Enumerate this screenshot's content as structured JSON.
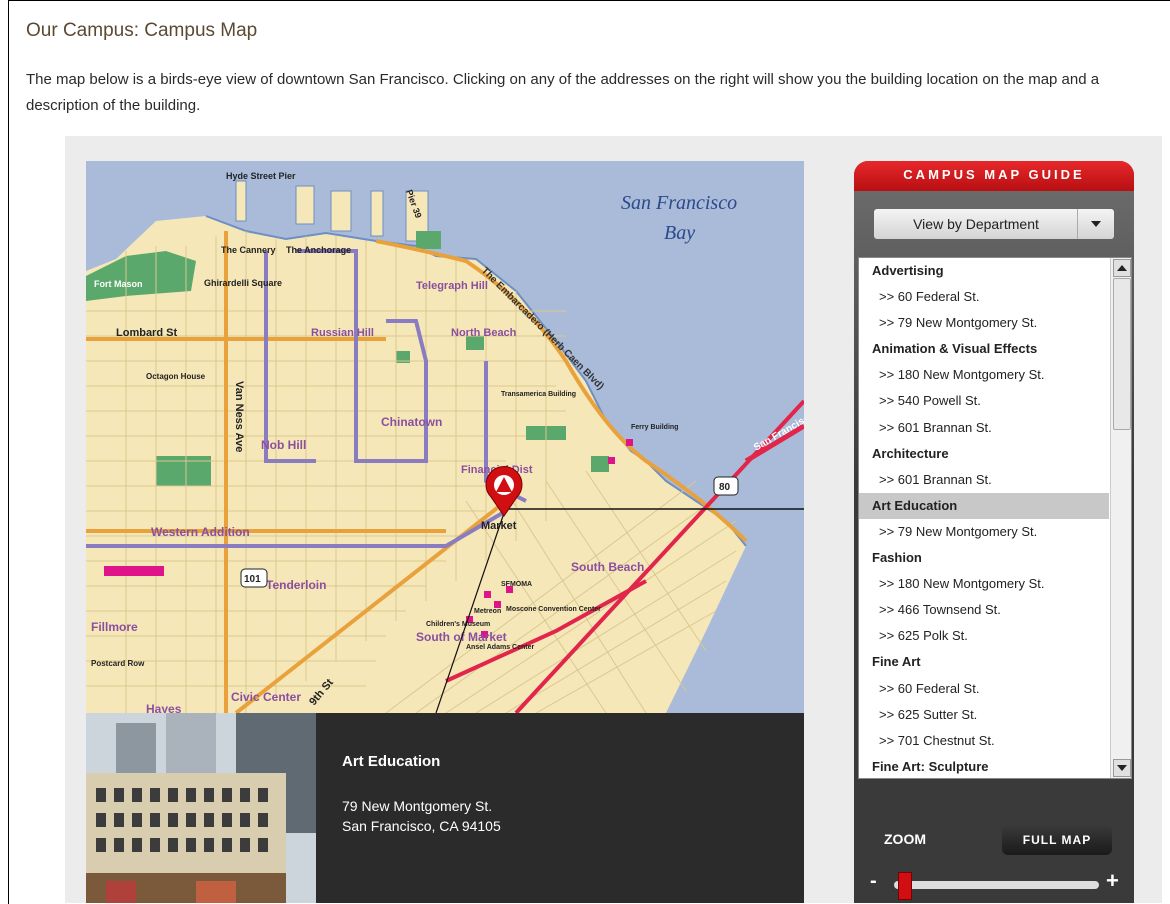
{
  "page": {
    "title": "Our Campus: Campus Map",
    "intro": "The map below is a birds-eye view of downtown San Francisco. Clicking on any of the addresses on the right will show you the building location on the map and a description of the building."
  },
  "map": {
    "water_label": "San Francisco Bay",
    "water_label_line1": "San Francisco",
    "water_label_line2": "Bay",
    "labels": {
      "pier_hyde": "Hyde Street Pier",
      "pier39": "Pier 39",
      "fort_mason": "Fort Mason",
      "ghirardelli": "Ghirardelli Square",
      "cannery": "The Cannery",
      "anchorage": "The Anchorage",
      "telegraph": "Telegraph Hill",
      "russian": "Russian Hill",
      "north_beach": "North Beach",
      "embarcadero": "The Embarcadero (Herb Caen Blvd)",
      "lombard": "Lombard St",
      "octagon": "Octagon House",
      "chinatown": "Chinatown",
      "nob_hill": "Nob Hill",
      "van_ness": "Van Ness Ave",
      "financial": "Financial Dist",
      "western": "Western Addition",
      "tenderloin": "Tenderloin",
      "south_beach": "South Beach",
      "som": "South of Market",
      "fillmore": "Fillmore",
      "postcard": "Postcard Row",
      "civic": "Civic Center",
      "hayes": "Hayes",
      "market": "Market",
      "ninth": "9th St",
      "sf_bridge": "San Francisco",
      "hwy80": "80",
      "hwy101": "101",
      "ferry": "Ferry Building",
      "transamerica": "Transamerica Building",
      "sfmoma": "SFMOMA",
      "moscone": "Moscone Convention Center",
      "metreon": "Metreon",
      "childrens": "Children's Museum",
      "ansel": "Ansel Adams Center"
    },
    "colors": {
      "water": "#a9bbd9",
      "land": "#f6e7b8",
      "park": "#5aa86b",
      "route": "#8a7cc0",
      "rail": "#e2254a",
      "freeway": "#e9a13b",
      "pin": "#d10f12"
    }
  },
  "info": {
    "title": "Art Education",
    "address_line1": "79 New Montgomery St.",
    "address_line2": "San Francisco, CA 94105"
  },
  "guide": {
    "header": "CAMPUS MAP GUIDE",
    "select_value": "View by Department",
    "zoom_label": "ZOOM",
    "full_map_label": "FULL MAP",
    "zoom_minus": "-",
    "zoom_plus": "+",
    "zoom_level": 0.05,
    "list": [
      {
        "type": "dept",
        "label": "Advertising"
      },
      {
        "type": "addr",
        "label": ">> 60 Federal St."
      },
      {
        "type": "addr",
        "label": ">> 79 New Montgomery St."
      },
      {
        "type": "dept",
        "label": "Animation & Visual Effects"
      },
      {
        "type": "addr",
        "label": ">> 180 New Montgomery St."
      },
      {
        "type": "addr",
        "label": ">> 540 Powell St."
      },
      {
        "type": "addr",
        "label": ">> 601 Brannan St."
      },
      {
        "type": "dept",
        "label": "Architecture"
      },
      {
        "type": "addr",
        "label": ">> 601 Brannan St."
      },
      {
        "type": "dept",
        "label": "Art Education",
        "selected": true
      },
      {
        "type": "addr",
        "label": ">> 79 New Montgomery St."
      },
      {
        "type": "dept",
        "label": "Fashion"
      },
      {
        "type": "addr",
        "label": ">> 180 New Montgomery St."
      },
      {
        "type": "addr",
        "label": ">> 466 Townsend St."
      },
      {
        "type": "addr",
        "label": ">> 625 Polk St."
      },
      {
        "type": "dept",
        "label": "Fine Art"
      },
      {
        "type": "addr",
        "label": ">> 60 Federal St."
      },
      {
        "type": "addr",
        "label": ">> 625 Sutter St."
      },
      {
        "type": "addr",
        "label": ">> 701 Chestnut St."
      },
      {
        "type": "dept",
        "label": "Fine Art: Sculpture"
      }
    ]
  }
}
